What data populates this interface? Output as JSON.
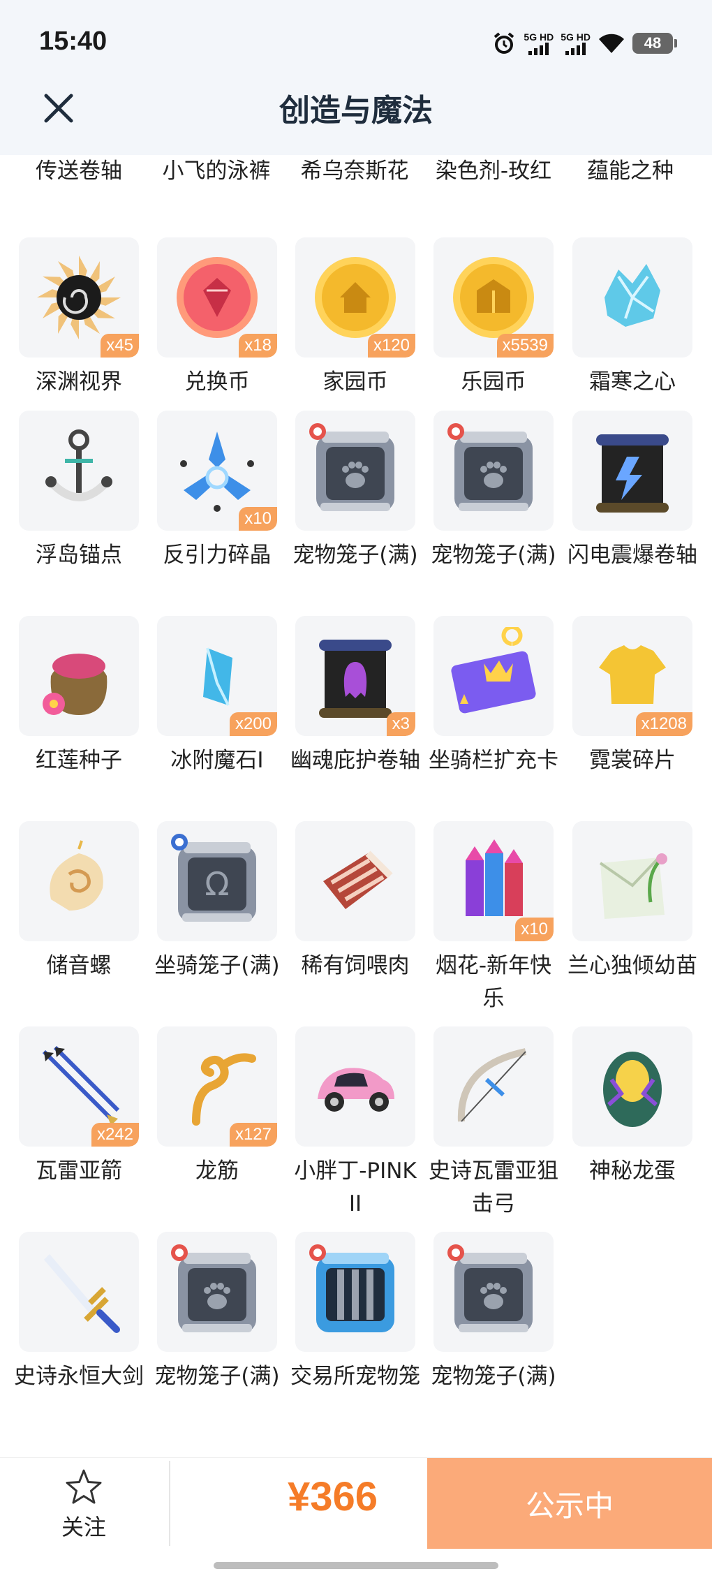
{
  "status_bar": {
    "time": "15:40",
    "sim1": "5G HD",
    "sim2": "5G HD",
    "battery": "48"
  },
  "header": {
    "title": "创造与魔法",
    "close_icon": "close-icon"
  },
  "partial_row": [
    "传送卷轴",
    "小飞的泳裤",
    "希乌奈斯花",
    "染色剂-玫红",
    "蕴能之种"
  ],
  "items": [
    {
      "name": "深渊视界",
      "count": "x45",
      "icon": "abyss-sun-icon"
    },
    {
      "name": "兑换币",
      "count": "x18",
      "icon": "exchange-coin-icon"
    },
    {
      "name": "家园币",
      "count": "x120",
      "icon": "home-coin-icon"
    },
    {
      "name": "乐园币",
      "count": "x5539",
      "icon": "park-coin-icon"
    },
    {
      "name": "霜寒之心",
      "count": "",
      "icon": "frost-heart-icon"
    },
    {
      "name": "浮岛锚点",
      "count": "",
      "icon": "anchor-icon"
    },
    {
      "name": "反引力碎晶",
      "count": "x10",
      "icon": "crystal-shard-icon"
    },
    {
      "name": "宠物笼子(满)",
      "count": "",
      "icon": "pet-cage-icon"
    },
    {
      "name": "宠物笼子(满)",
      "count": "",
      "icon": "pet-cage-icon"
    },
    {
      "name": "闪电震爆卷轴",
      "count": "",
      "icon": "lightning-scroll-icon"
    },
    {
      "name": "红莲种子",
      "count": "",
      "icon": "seed-bag-icon"
    },
    {
      "name": "冰附魔石I",
      "count": "x200",
      "icon": "ice-stone-icon"
    },
    {
      "name": "幽魂庇护卷轴",
      "count": "x3",
      "icon": "ghost-scroll-icon"
    },
    {
      "name": "坐骑栏扩充卡",
      "count": "",
      "icon": "mount-card-icon"
    },
    {
      "name": "霓裳碎片",
      "count": "x1208",
      "icon": "shirt-fragment-icon"
    },
    {
      "name": "储音螺",
      "count": "",
      "icon": "conch-icon"
    },
    {
      "name": "坐骑笼子(满)",
      "count": "",
      "icon": "mount-cage-icon"
    },
    {
      "name": "稀有饲喂肉",
      "count": "",
      "icon": "meat-icon"
    },
    {
      "name": "烟花-新年快乐",
      "count": "x10",
      "icon": "fireworks-icon"
    },
    {
      "name": "兰心独倾幼苗",
      "count": "",
      "icon": "seedling-bag-icon"
    },
    {
      "name": "瓦雷亚箭",
      "count": "x242",
      "icon": "arrows-icon"
    },
    {
      "name": "龙筋",
      "count": "x127",
      "icon": "dragon-tendon-icon"
    },
    {
      "name": "小胖丁-PINK II",
      "count": "",
      "icon": "pink-car-icon"
    },
    {
      "name": "史诗瓦雷亚狙击弓",
      "count": "",
      "icon": "bow-icon"
    },
    {
      "name": "神秘龙蛋",
      "count": "",
      "icon": "dragon-egg-icon"
    },
    {
      "name": "史诗永恒大剑",
      "count": "",
      "icon": "sword-icon"
    },
    {
      "name": "宠物笼子(满)",
      "count": "",
      "icon": "pet-cage-icon"
    },
    {
      "name": "交易所宠物笼",
      "count": "",
      "icon": "trade-cage-icon"
    },
    {
      "name": "宠物笼子(满)",
      "count": "",
      "icon": "pet-cage-icon"
    }
  ],
  "bottom_bar": {
    "follow_label": "关注",
    "price": "¥366",
    "status_label": "公示中"
  },
  "colors": {
    "accent_orange": "#f57c28",
    "status_button": "#fbaa79",
    "badge": "#f7a25d",
    "header_bg": "#f3f6fa"
  }
}
